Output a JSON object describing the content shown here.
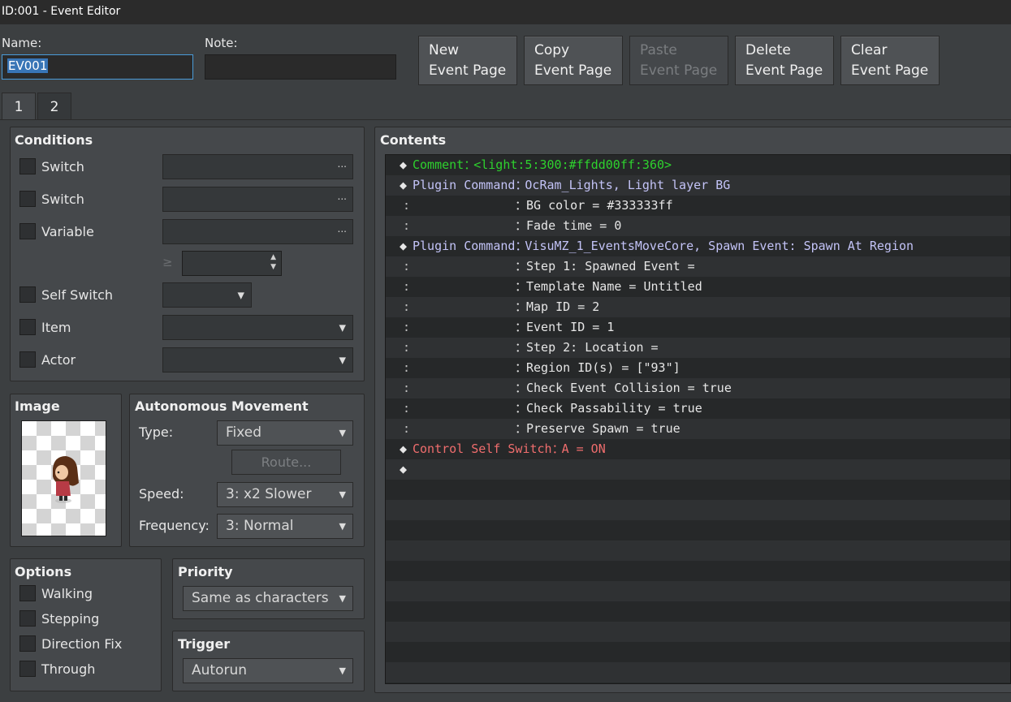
{
  "window": {
    "title": "ID:001 - Event Editor"
  },
  "header": {
    "name_label": "Name:",
    "name_value": "EV001",
    "note_label": "Note:",
    "note_value": "",
    "buttons": [
      {
        "line1": "New",
        "line2": "Event Page",
        "enabled": true
      },
      {
        "line1": "Copy",
        "line2": "Event Page",
        "enabled": true
      },
      {
        "line1": "Paste",
        "line2": "Event Page",
        "enabled": false
      },
      {
        "line1": "Delete",
        "line2": "Event Page",
        "enabled": true
      },
      {
        "line1": "Clear",
        "line2": "Event Page",
        "enabled": true
      }
    ]
  },
  "tabs": [
    {
      "label": "1",
      "active": true
    },
    {
      "label": "2",
      "active": false
    }
  ],
  "conditions": {
    "title": "Conditions",
    "switch1": "Switch",
    "switch2": "Switch",
    "variable": "Variable",
    "operator": "≥",
    "self_switch": "Self Switch",
    "item": "Item",
    "actor": "Actor",
    "dots": "..."
  },
  "image": {
    "title": "Image"
  },
  "movement": {
    "title": "Autonomous Movement",
    "type_label": "Type:",
    "type_value": "Fixed",
    "route_label": "Route...",
    "speed_label": "Speed:",
    "speed_value": "3: x2 Slower",
    "frequency_label": "Frequency:",
    "frequency_value": "3: Normal"
  },
  "options": {
    "title": "Options",
    "walking": "Walking",
    "stepping": "Stepping",
    "direction_fix": "Direction Fix",
    "through": "Through"
  },
  "priority": {
    "title": "Priority",
    "value": "Same as characters"
  },
  "trigger": {
    "title": "Trigger",
    "value": "Autorun"
  },
  "contents": {
    "title": "Contents",
    "diamond": "◆",
    "colon": ":",
    "sep": "：",
    "lines": [
      {
        "kind": "cmd",
        "command": "Comment",
        "value": "<light:5:300:#ffdd00ff:360>",
        "color": "#2ed12e",
        "cmd_color": "#2ed12e"
      },
      {
        "kind": "cmd",
        "command": "Plugin Command",
        "value": "OcRam_Lights, Light layer BG",
        "color": "#c3c3f7",
        "cmd_color": "#c3c3f7"
      },
      {
        "kind": "cont",
        "value": "BG color = #333333ff"
      },
      {
        "kind": "cont",
        "value": "Fade time = 0"
      },
      {
        "kind": "cmd",
        "command": "Plugin Command",
        "value": "VisuMZ_1_EventsMoveCore, Spawn Event: Spawn At Region",
        "color": "#c3c3f7",
        "cmd_color": "#c3c3f7"
      },
      {
        "kind": "cont",
        "value": "Step 1: Spawned Event ="
      },
      {
        "kind": "cont",
        "value": "Template Name = Untitled"
      },
      {
        "kind": "cont",
        "value": "Map ID = 2"
      },
      {
        "kind": "cont",
        "value": "Event ID = 1"
      },
      {
        "kind": "cont",
        "value": "Step 2: Location ="
      },
      {
        "kind": "cont",
        "value": "Region ID(s) = [\"93\"]"
      },
      {
        "kind": "cont",
        "value": "Check Event Collision = true"
      },
      {
        "kind": "cont",
        "value": "Check Passability = true"
      },
      {
        "kind": "cont",
        "value": "Preserve Spawn = true"
      },
      {
        "kind": "cmd",
        "command": "Control Self Switch",
        "value": "A = ON",
        "color": "#ef6d6d",
        "cmd_color": "#ef6d6d"
      },
      {
        "kind": "empty"
      }
    ]
  }
}
